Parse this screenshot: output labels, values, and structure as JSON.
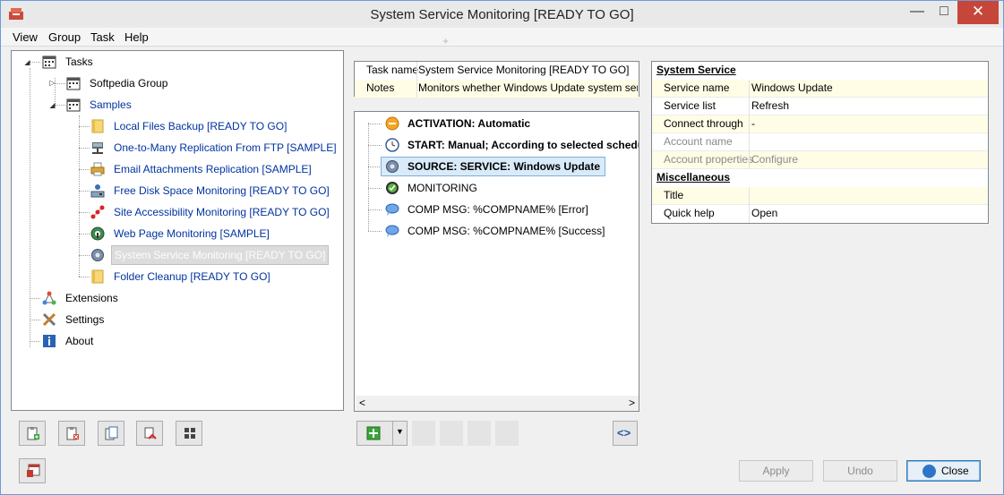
{
  "window": {
    "title": "System Service Monitoring [READY TO GO]",
    "minimize_glyph": "—",
    "maximize_glyph": "□",
    "close_glyph": "✕"
  },
  "menu": [
    "View",
    "Group",
    "Task",
    "Help"
  ],
  "tree": {
    "root": "Tasks",
    "group1": "Softpedia Group",
    "group2": "Samples",
    "samples": [
      "Local Files Backup [READY TO GO]",
      "One-to-Many Replication From FTP [SAMPLE]",
      "Email Attachments Replication [SAMPLE]",
      "Free Disk Space Monitoring [READY TO GO]",
      "Site Accessibility Monitoring [READY TO GO]",
      "Web Page Monitoring [SAMPLE]",
      "System Service Monitoring [READY TO GO]",
      "Folder Cleanup [READY TO GO]"
    ],
    "others": [
      "Extensions",
      "Settings",
      "About"
    ]
  },
  "task_info": {
    "name_label": "Task name",
    "name_value": "System Service Monitoring [READY TO GO]",
    "notes_label": "Notes",
    "notes_value": "Monitors whether Windows Update system service"
  },
  "steps": [
    "ACTIVATION: Automatic",
    "START: Manual; According to selected schedule",
    "SOURCE: SERVICE: Windows Update",
    "MONITORING",
    "COMP MSG: %COMPNAME% [Error]",
    "COMP MSG: %COMPNAME% [Success]"
  ],
  "properties": {
    "cat1": "System Service",
    "service_name_label": "Service name",
    "service_name_value": "Windows Update",
    "service_list_label": "Service list",
    "service_list_value": "Refresh",
    "connect_label": "Connect through",
    "connect_value": "-",
    "account_name_label": "Account name",
    "account_props_label": "Account properties",
    "account_props_value": "Configure",
    "cat2": "Miscellaneous",
    "title_label": "Title",
    "quick_help_label": "Quick help",
    "quick_help_value": "Open"
  },
  "buttons": {
    "apply": "Apply",
    "undo": "Undo",
    "close": "Close",
    "dropdown_glyph": "▼",
    "code_glyph": "<>",
    "scroll_left": "<",
    "scroll_right": ">"
  },
  "colors": {
    "link": "#0033a0",
    "selection": "#d9ebf9",
    "alt_row": "#fffde6",
    "close_button": "#c7463a"
  }
}
